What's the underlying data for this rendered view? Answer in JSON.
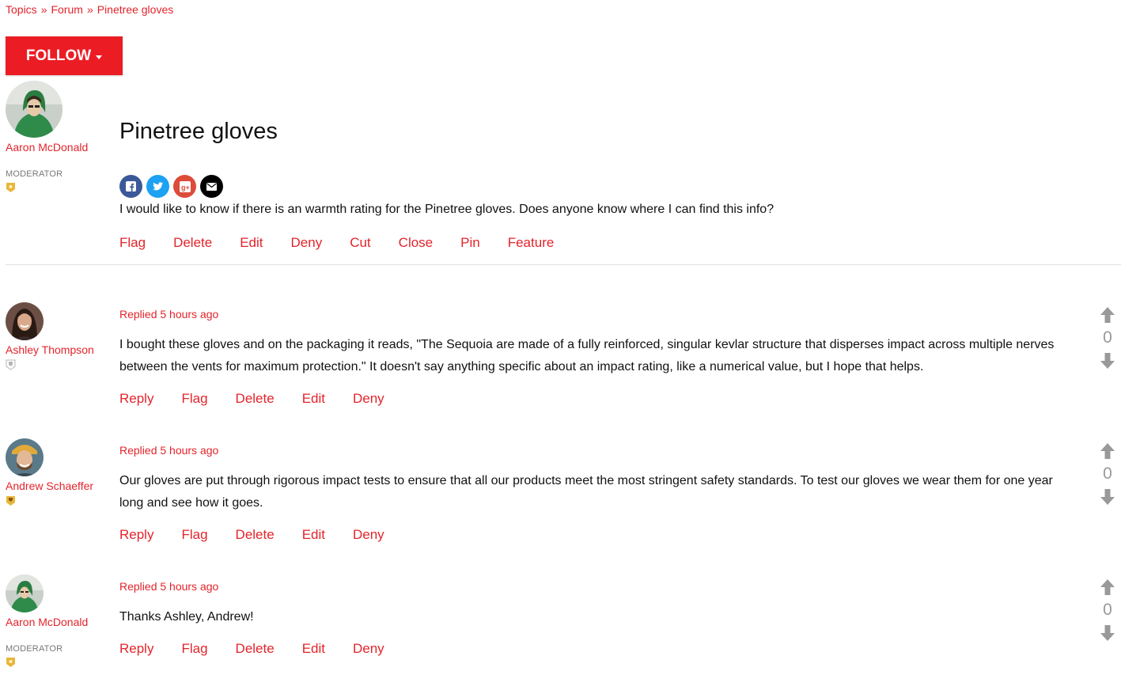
{
  "breadcrumb": {
    "items": [
      "Topics",
      "Forum",
      "Pinetree gloves"
    ],
    "separator": "»"
  },
  "follow_button": {
    "label": "FOLLOW"
  },
  "topic": {
    "title": "Pinetree gloves",
    "body": "I would like to know if there is an warmth rating for the Pinetree gloves. Does anyone know where I can find this info?",
    "author": {
      "name": "Aaron McDonald",
      "role": "MODERATOR"
    },
    "share_icons": [
      "facebook-icon",
      "twitter-icon",
      "google-plus-icon",
      "email-icon"
    ],
    "actions": [
      "Flag",
      "Delete",
      "Edit",
      "Deny",
      "Cut",
      "Close",
      "Pin",
      "Feature"
    ]
  },
  "replies": [
    {
      "author": {
        "name": "Ashley Thompson",
        "role": ""
      },
      "time": "Replied 5 hours ago",
      "body": "I bought these gloves and on the packaging it reads, \"The Sequoia are made of a fully reinforced, singular kevlar structure that disperses impact across multiple nerves between the vents for maximum protection.\" It doesn't say anything specific about an impact rating, like a numerical value, but I hope that helps.",
      "actions": [
        "Reply",
        "Flag",
        "Delete",
        "Edit",
        "Deny"
      ],
      "votes": "0"
    },
    {
      "author": {
        "name": "Andrew Schaeffer",
        "role": ""
      },
      "time": "Replied 5 hours ago",
      "body": "Our gloves are put through rigorous impact tests to ensure that all our products meet the most stringent safety standards. To test our gloves we wear them for one year long and see how it goes.",
      "actions": [
        "Reply",
        "Flag",
        "Delete",
        "Edit",
        "Deny"
      ],
      "votes": "0"
    },
    {
      "author": {
        "name": "Aaron McDonald",
        "role": "MODERATOR"
      },
      "time": "Replied 5 hours ago",
      "body": "Thanks Ashley, Andrew!",
      "actions": [
        "Reply",
        "Flag",
        "Delete",
        "Edit",
        "Deny"
      ],
      "votes": "0"
    }
  ],
  "colors": {
    "accent": "#e3242b",
    "follow_bg": "#ec1c24",
    "facebook": "#3b5998",
    "twitter": "#1da1f2",
    "google_plus": "#dd4b39",
    "email": "#000000",
    "badge_gold": "#e8b63a",
    "badge_gray": "#b5b5b5",
    "vote_gray": "#999999"
  }
}
